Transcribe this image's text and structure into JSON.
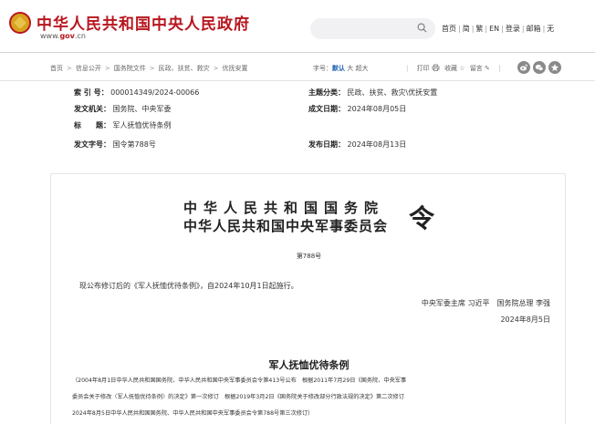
{
  "header": {
    "site_title": "中华人民共和国中央人民政府",
    "site_url_prefix": "www.",
    "site_url_gov": "gov",
    "site_url_suffix": ".cn",
    "links": [
      "首页",
      "简",
      "繁",
      "EN",
      "登录",
      "邮箱",
      "无"
    ],
    "brand_color": "#b8161e"
  },
  "breadcrumb": {
    "items": [
      "首页",
      "信息公开",
      "国务院文件",
      "民政、扶贫、救灾",
      "优抚安置"
    ]
  },
  "font_size": {
    "label": "字号：",
    "options": [
      "默认",
      "大",
      "超大"
    ],
    "selected": "默认"
  },
  "tools": {
    "print": "打印",
    "favorite": "收藏",
    "message": "留言"
  },
  "share": {
    "icons": [
      "weibo-icon",
      "wechat-icon",
      "qzone-icon"
    ]
  },
  "meta": {
    "index_label": "索 引 号：",
    "index_value": "000014349/2024-00066",
    "category_label": "主题分类：",
    "category_value": "民政、扶贫、救灾\\优抚安置",
    "issuer_label": "发文机关：",
    "issuer_value": "国务院、中央军委",
    "date_label": "成文日期：",
    "date_value": "2024年08月05日",
    "title_label": "标　　题：",
    "title_value": "军人抚恤优待条例",
    "docno_label": "发文字号：",
    "docno_value": "国令第788号",
    "publish_label": "发布日期：",
    "publish_value": "2024年08月13日"
  },
  "document": {
    "heading_line1": "中华人民共和国国务院",
    "heading_line2": "中华人民共和国中央军事委员会",
    "heading_ling": "令",
    "order_no": "第788号",
    "intro": "现公布修订后的《军人抚恤优待条例》，自2024年10月1日起施行。",
    "signers": "中央军委主席 习近平　国务院总理 李强",
    "sign_date": "2024年8月5日",
    "reg_title": "军人抚恤优待条例",
    "note_lines": [
      "（2004年8月1日中华人民共和国国务院、中华人民共和国中央军事委员会令第413号公布　根据2011年7月29日《国务院、中央军事",
      "委员会关于修改〈军人抚恤优待条例〉的决定》第一次修订　根据2019年3月2日《国务院关于修改部分行政法规的决定》第二次修订",
      "2024年8月5日中华人民共和国国务院、中华人民共和国中央军事委员会令第788号第三次修订）"
    ]
  }
}
